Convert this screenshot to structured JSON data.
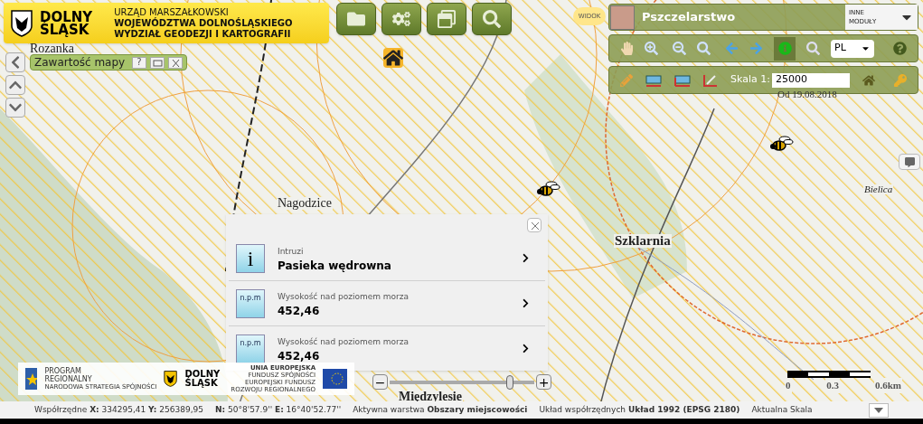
{
  "header": {
    "logo_lines": [
      "DOLNY",
      "ŚLĄSK"
    ],
    "title_lines": [
      "URZĄD MARSZAŁKOWSKI",
      "WOJEWÓDZTWA DOLNOŚLĄSKIEGO",
      "WYDZIAŁ GEODEZJI I KARTOGRAFII"
    ]
  },
  "map_contents_panel": {
    "title": "Zawartość mapy",
    "help": "?"
  },
  "view_toggle": "WIDOK",
  "module": {
    "name": "Pszczelarstwo",
    "other_modules": [
      "INNE",
      "MODUŁY"
    ]
  },
  "language": "PL",
  "scale": {
    "label": "Skala 1:",
    "value": "25000"
  },
  "date_label": "Od 19.08.2018",
  "place_names": [
    {
      "name": "Rozanka"
    },
    {
      "name": "Nagodzice"
    },
    {
      "name": "Szklarnia"
    },
    {
      "name": "Bielica"
    },
    {
      "name": "Międzylesie"
    }
  ],
  "popup": {
    "items": [
      {
        "kind": "info",
        "icon_text": "i",
        "category": "Intruzi",
        "value": "Pasieka wędrowna"
      },
      {
        "kind": "elevation",
        "icon_text": "n.p.m",
        "category": "Wysokość nad poziomem morza",
        "value": "452,46"
      },
      {
        "kind": "elevation",
        "icon_text": "n.p.m",
        "category": "Wysokość nad poziomem morza",
        "value": "452,46"
      }
    ]
  },
  "footer_logos": {
    "program": [
      "PROGRAM",
      "REGIONALNY",
      "NARODOWA STRATEGIA SPÓJNOŚCI"
    ],
    "region": [
      "DOLNY",
      "ŚLĄSK"
    ],
    "eu": [
      "UNIA EUROPEJSKA",
      "FUNDUSZ SPÓJNOŚCI",
      "EUROPEJSKI FUNDUSZ",
      "ROZWOJU REGIONALNEGO"
    ]
  },
  "zoom_slider": {
    "minus": "−",
    "plus": "+",
    "level": 0.85
  },
  "scale_bar": [
    "0",
    "0.3",
    "0.6km"
  ],
  "status_bar": [
    "Współrzędne **X:** 334295,41 **Y:** 256389,95",
    "**N:** 50°8'57.9'' **E:** 16°40'52.77''",
    "Aktywna warstwa **Obszary miejscowości**",
    "Układ współrzędnych **Układ 1992 (EPSG 2180)**",
    "Aktualna Skala"
  ]
}
